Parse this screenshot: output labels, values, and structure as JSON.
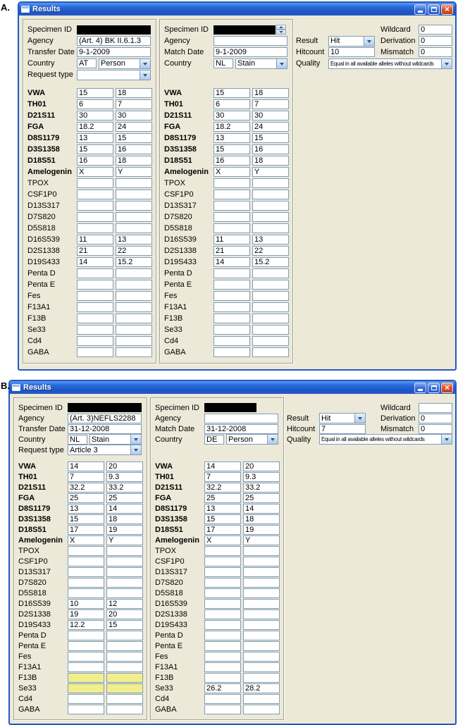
{
  "colors": {
    "window_bg": "#ECE9D8",
    "titlebar_blue": "#2459C0",
    "close_red": "#DE5835",
    "input_border": "#7F9DB9",
    "highlight_yellow": "#F2EE8C",
    "redaction_black": "#000000"
  },
  "figures": [
    {
      "label": "A.",
      "title": "Results",
      "left_panel": {
        "specimen_label": "Specimen ID",
        "agency_label": "Agency",
        "agency_value": "(Art. 4) BK II.6.1.3",
        "date_label": "Transfer Date",
        "date_value": "9-1-2009",
        "country_label": "Country",
        "country_code": "AT",
        "country_type": "Person",
        "request_label": "Request type",
        "request_value": ""
      },
      "middle_panel": {
        "specimen_label": "Specimen ID",
        "agency_label": "Agency",
        "agency_value": "",
        "date_label": "Match Date",
        "date_value": "9-1-2009",
        "country_label": "Country",
        "country_code": "NL",
        "country_type": "Stain"
      },
      "match": {
        "result_label": "Result",
        "result_value": "Hit",
        "hitcount_label": "Hitcount",
        "hitcount_value": "10",
        "quality_label": "Quality",
        "quality_value": "Equal in all available alleles without wildcards",
        "wildcard_label": "Wildcard",
        "wildcard_value": "0",
        "derivation_label": "Derivation",
        "derivation_value": "0",
        "mismatch_label": "Mismatch",
        "mismatch_value": "0"
      },
      "loci": [
        {
          "name": "VWA",
          "bold": true,
          "left": [
            "15",
            "18"
          ],
          "right": [
            "15",
            "18"
          ]
        },
        {
          "name": "TH01",
          "bold": true,
          "left": [
            "6",
            "7"
          ],
          "right": [
            "6",
            "7"
          ]
        },
        {
          "name": "D21S11",
          "bold": true,
          "left": [
            "30",
            "30"
          ],
          "right": [
            "30",
            "30"
          ]
        },
        {
          "name": "FGA",
          "bold": true,
          "left": [
            "18.2",
            "24"
          ],
          "right": [
            "18.2",
            "24"
          ]
        },
        {
          "name": "D8S1179",
          "bold": true,
          "left": [
            "13",
            "15"
          ],
          "right": [
            "13",
            "15"
          ]
        },
        {
          "name": "D3S1358",
          "bold": true,
          "left": [
            "15",
            "16"
          ],
          "right": [
            "15",
            "16"
          ]
        },
        {
          "name": "D18S51",
          "bold": true,
          "left": [
            "16",
            "18"
          ],
          "right": [
            "16",
            "18"
          ]
        },
        {
          "name": "Amelogenin",
          "bold": true,
          "left": [
            "X",
            "Y"
          ],
          "right": [
            "X",
            "Y"
          ]
        },
        {
          "name": "TPOX",
          "bold": false,
          "left": [
            "",
            ""
          ],
          "right": [
            "",
            ""
          ]
        },
        {
          "name": "CSF1P0",
          "bold": false,
          "left": [
            "",
            ""
          ],
          "right": [
            "",
            ""
          ]
        },
        {
          "name": "D13S317",
          "bold": false,
          "left": [
            "",
            ""
          ],
          "right": [
            "",
            ""
          ]
        },
        {
          "name": "D7S820",
          "bold": false,
          "left": [
            "",
            ""
          ],
          "right": [
            "",
            ""
          ]
        },
        {
          "name": "D5S818",
          "bold": false,
          "left": [
            "",
            ""
          ],
          "right": [
            "",
            ""
          ]
        },
        {
          "name": "D16S539",
          "bold": false,
          "left": [
            "11",
            "13"
          ],
          "right": [
            "11",
            "13"
          ]
        },
        {
          "name": "D2S1338",
          "bold": false,
          "left": [
            "21",
            "22"
          ],
          "right": [
            "21",
            "22"
          ]
        },
        {
          "name": "D19S433",
          "bold": false,
          "left": [
            "14",
            "15.2"
          ],
          "right": [
            "14",
            "15.2"
          ]
        },
        {
          "name": "Penta D",
          "bold": false,
          "left": [
            "",
            ""
          ],
          "right": [
            "",
            ""
          ]
        },
        {
          "name": "Penta E",
          "bold": false,
          "left": [
            "",
            ""
          ],
          "right": [
            "",
            ""
          ]
        },
        {
          "name": "Fes",
          "bold": false,
          "left": [
            "",
            ""
          ],
          "right": [
            "",
            ""
          ]
        },
        {
          "name": "F13A1",
          "bold": false,
          "left": [
            "",
            ""
          ],
          "right": [
            "",
            ""
          ]
        },
        {
          "name": "F13B",
          "bold": false,
          "left": [
            "",
            ""
          ],
          "right": [
            "",
            ""
          ]
        },
        {
          "name": "Se33",
          "bold": false,
          "left": [
            "",
            ""
          ],
          "right": [
            "",
            ""
          ]
        },
        {
          "name": "Cd4",
          "bold": false,
          "left": [
            "",
            ""
          ],
          "right": [
            "",
            ""
          ]
        },
        {
          "name": "GABA",
          "bold": false,
          "left": [
            "",
            ""
          ],
          "right": [
            "",
            ""
          ]
        }
      ]
    },
    {
      "label": "B.",
      "title": "Results",
      "left_panel": {
        "specimen_label": "Specimen ID",
        "agency_label": "Agency",
        "agency_value": "(Art. 3)NEFLS2288",
        "date_label": "Transfer Date",
        "date_value": "31-12-2008",
        "country_label": "Country",
        "country_code": "NL",
        "country_type": "Stain",
        "request_label": "Request type",
        "request_value": "Article 3"
      },
      "middle_panel": {
        "specimen_label": "Specimen ID",
        "agency_label": "Agency",
        "agency_value": "",
        "date_label": "Match Date",
        "date_value": "31-12-2008",
        "country_label": "Country",
        "country_code": "DE",
        "country_type": "Person"
      },
      "match": {
        "result_label": "Result",
        "result_value": "Hit",
        "hitcount_label": "Hitcount",
        "hitcount_value": "7",
        "quality_label": "Quality",
        "quality_value": "Equal in all available alleles without wildcards",
        "wildcard_label": "Wildcard",
        "wildcard_value": "",
        "derivation_label": "Derivation",
        "derivation_value": "0",
        "mismatch_label": "Mismatch",
        "mismatch_value": "0"
      },
      "loci": [
        {
          "name": "VWA",
          "bold": true,
          "left": [
            "14",
            "20"
          ],
          "right": [
            "14",
            "20"
          ]
        },
        {
          "name": "TH01",
          "bold": true,
          "left": [
            "7",
            "9.3"
          ],
          "right": [
            "7",
            "9.3"
          ]
        },
        {
          "name": "D21S11",
          "bold": true,
          "left": [
            "32.2",
            "33.2"
          ],
          "right": [
            "32.2",
            "33.2"
          ]
        },
        {
          "name": "FGA",
          "bold": true,
          "left": [
            "25",
            "25"
          ],
          "right": [
            "25",
            "25"
          ]
        },
        {
          "name": "D8S1179",
          "bold": true,
          "left": [
            "13",
            "14"
          ],
          "right": [
            "13",
            "14"
          ]
        },
        {
          "name": "D3S1358",
          "bold": true,
          "left": [
            "15",
            "18"
          ],
          "right": [
            "15",
            "18"
          ]
        },
        {
          "name": "D18S51",
          "bold": true,
          "left": [
            "17",
            "19"
          ],
          "right": [
            "17",
            "19"
          ]
        },
        {
          "name": "Amelogenin",
          "bold": true,
          "left": [
            "X",
            "Y"
          ],
          "right": [
            "X",
            "Y"
          ]
        },
        {
          "name": "TPOX",
          "bold": false,
          "left": [
            "",
            ""
          ],
          "right": [
            "",
            ""
          ]
        },
        {
          "name": "CSF1P0",
          "bold": false,
          "left": [
            "",
            ""
          ],
          "right": [
            "",
            ""
          ]
        },
        {
          "name": "D13S317",
          "bold": false,
          "left": [
            "",
            ""
          ],
          "right": [
            "",
            ""
          ]
        },
        {
          "name": "D7S820",
          "bold": false,
          "left": [
            "",
            ""
          ],
          "right": [
            "",
            ""
          ]
        },
        {
          "name": "D5S818",
          "bold": false,
          "left": [
            "",
            ""
          ],
          "right": [
            "",
            ""
          ]
        },
        {
          "name": "D16S539",
          "bold": false,
          "left": [
            "10",
            "12"
          ],
          "right": [
            "",
            ""
          ]
        },
        {
          "name": "D2S1338",
          "bold": false,
          "left": [
            "19",
            "20"
          ],
          "right": [
            "",
            ""
          ]
        },
        {
          "name": "D19S433",
          "bold": false,
          "left": [
            "12.2",
            "15"
          ],
          "right": [
            "",
            ""
          ]
        },
        {
          "name": "Penta D",
          "bold": false,
          "left": [
            "",
            ""
          ],
          "right": [
            "",
            ""
          ]
        },
        {
          "name": "Penta E",
          "bold": false,
          "left": [
            "",
            ""
          ],
          "right": [
            "",
            ""
          ]
        },
        {
          "name": "Fes",
          "bold": false,
          "left": [
            "",
            ""
          ],
          "right": [
            "",
            ""
          ]
        },
        {
          "name": "F13A1",
          "bold": false,
          "left": [
            "",
            ""
          ],
          "right": [
            "",
            ""
          ]
        },
        {
          "name": "F13B",
          "bold": false,
          "left": [
            "",
            ""
          ],
          "left_highlight": true,
          "right": [
            "",
            ""
          ]
        },
        {
          "name": "Se33",
          "bold": false,
          "left": [
            "",
            ""
          ],
          "left_highlight": true,
          "right": [
            "26.2",
            "28.2"
          ]
        },
        {
          "name": "Cd4",
          "bold": false,
          "left": [
            "",
            ""
          ],
          "right": [
            "",
            ""
          ]
        },
        {
          "name": "GABA",
          "bold": false,
          "left": [
            "",
            ""
          ],
          "right": [
            "",
            ""
          ]
        }
      ]
    }
  ]
}
